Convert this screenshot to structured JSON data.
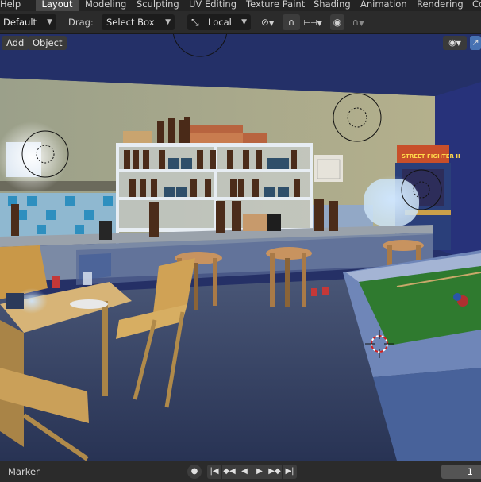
{
  "workspace_tabs": [
    "Help",
    "Layout",
    "Modeling",
    "Sculpting",
    "UV Editing",
    "Texture Paint",
    "Shading",
    "Animation",
    "Rendering",
    "Co"
  ],
  "active_tab": "Layout",
  "toolbar": {
    "orientation": "Default",
    "drag_label": "Drag:",
    "drag_value": "Select Box",
    "transform_orientation": "Local"
  },
  "viewport": {
    "menus": [
      "Add",
      "Object"
    ],
    "scene": {
      "poster_text": "STREET FIGHTER II"
    }
  },
  "timeline": {
    "marker_label": "Marker",
    "current_frame": "1"
  },
  "colors": {
    "accent": "#4772b3",
    "viewport_bg": "#253066",
    "header_bg": "#2b2b2b"
  }
}
